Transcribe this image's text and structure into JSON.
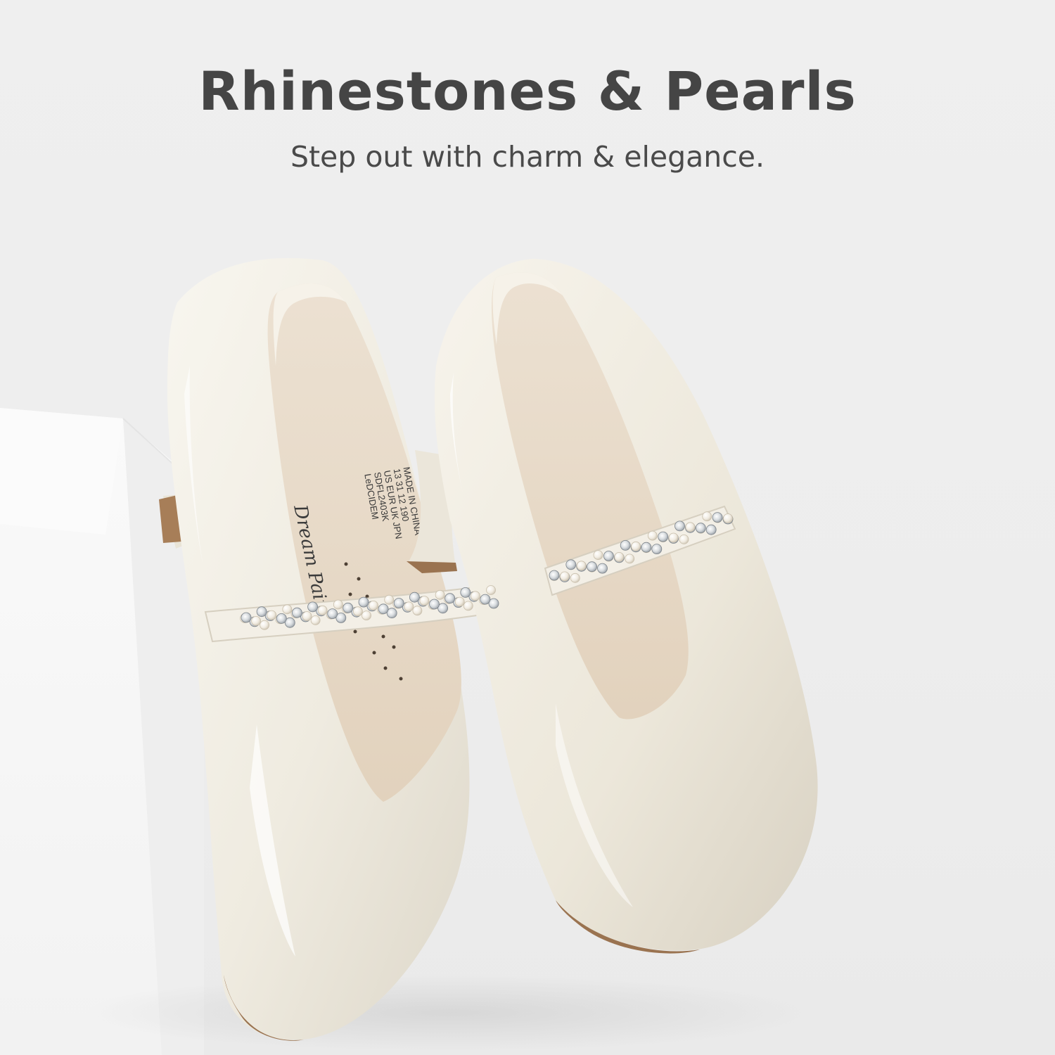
{
  "banner": {
    "title": "Rhinestones & Pearls",
    "tagline": "Step out with charm & elegance."
  },
  "product": {
    "insole_brand": "Dream Pairs",
    "insole_label": {
      "line1": "SDFL2403K",
      "line2": "US EUR UK JPN",
      "line3": "13 31 12 190",
      "line4": "MADE IN CHINA",
      "line5": "LeDCIDEM"
    }
  },
  "colors": {
    "background": "#efefef",
    "pedestal": "#f7f7f7",
    "shoe": "#f1ede2",
    "insole": "#e6d6c2",
    "sole": "#9a7350",
    "title_text": "#454545"
  }
}
